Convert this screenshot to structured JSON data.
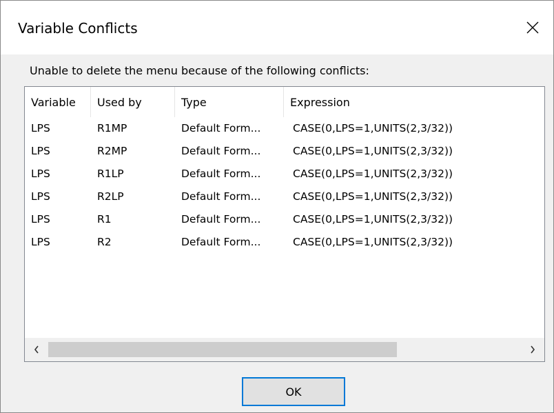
{
  "dialog": {
    "title": "Variable Conflicts",
    "message": "Unable to delete the menu because of the following conflicts:",
    "ok_label": "OK"
  },
  "icons": {
    "close": "close-icon",
    "scroll_left": "chevron-left-icon",
    "scroll_right": "chevron-right-icon"
  },
  "table": {
    "columns": [
      "Variable",
      "Used by",
      "Type",
      "Expression"
    ],
    "rows": [
      [
        "LPS",
        "R1MP",
        "Default Form...",
        "CASE(0,LPS=1,UNITS(2,3/32))"
      ],
      [
        "LPS",
        "R2MP",
        "Default Form...",
        "CASE(0,LPS=1,UNITS(2,3/32))"
      ],
      [
        "LPS",
        "R1LP",
        "Default Form...",
        "CASE(0,LPS=1,UNITS(2,3/32))"
      ],
      [
        "LPS",
        "R2LP",
        "Default Form...",
        "CASE(0,LPS=1,UNITS(2,3/32))"
      ],
      [
        "LPS",
        "R1",
        "Default Form...",
        "CASE(0,LPS=1,UNITS(2,3/32))"
      ],
      [
        "LPS",
        "R2",
        "Default Form...",
        "CASE(0,LPS=1,UNITS(2,3/32))"
      ]
    ]
  },
  "colors": {
    "accent": "#0078d7",
    "button_face": "#e1e1e1",
    "dialog_bg": "#f0f0f0"
  }
}
